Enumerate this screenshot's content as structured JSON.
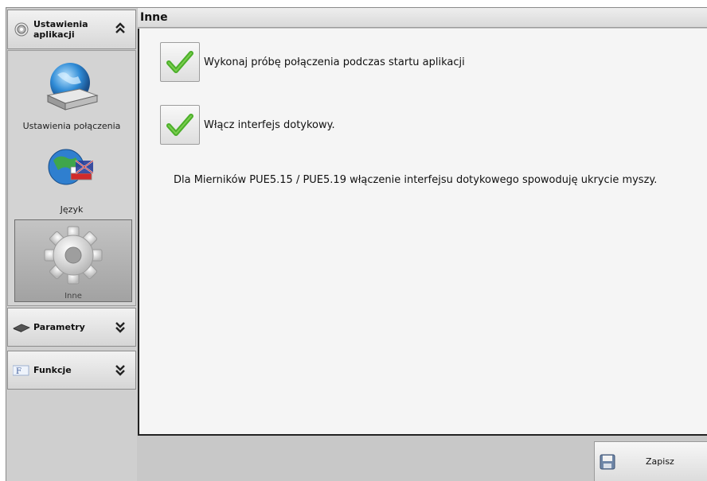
{
  "sidebar": {
    "app_settings": {
      "title_line1": "Ustawienia",
      "title_line2": "aplikacji",
      "icon": "settings-gear-icon",
      "chevron": "chevron-up-double-icon"
    },
    "items": [
      {
        "label": "Ustawienia połączenia",
        "icon": "network-connection-icon"
      },
      {
        "label": "Język",
        "icon": "language-globe-flags-icon"
      },
      {
        "label": "Inne",
        "icon": "gear-icon",
        "selected": true
      }
    ],
    "params": {
      "title": "Parametry",
      "icon": "chip-icon",
      "chevron": "chevron-down-double-icon"
    },
    "functions": {
      "title": "Funkcje",
      "icon": "function-icon",
      "chevron": "chevron-down-double-icon"
    }
  },
  "main": {
    "title": "Inne",
    "options": [
      {
        "label": "Wykonaj próbę połączenia podczas startu aplikacji",
        "checked": true
      },
      {
        "label": "Włącz interfejs dotykowy.",
        "checked": true
      }
    ],
    "info": "Dla Mierników PUE5.15 / PUE5.19 włączenie interfejsu dotykowego spowoduję ukrycie myszy."
  },
  "footer": {
    "save_label": "Zapisz",
    "save_icon": "floppy-disk-icon"
  },
  "colors": {
    "check": "#4caf2a",
    "panel": "#c8c8c8",
    "content": "#f5f5f5"
  }
}
